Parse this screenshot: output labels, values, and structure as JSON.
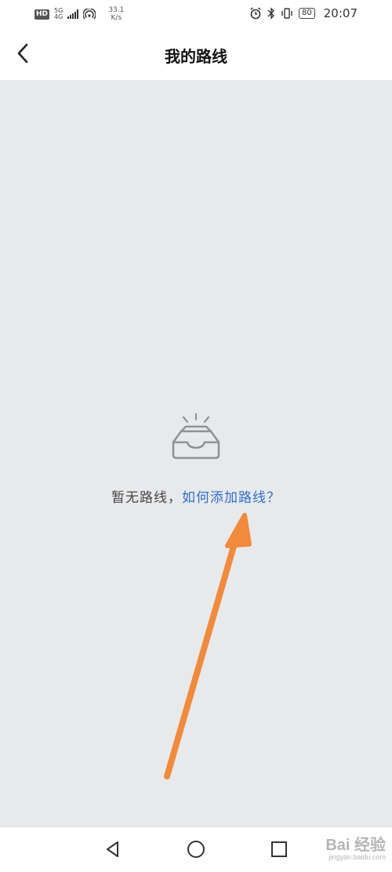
{
  "status_bar": {
    "hd": "HD",
    "network_gen": "5G",
    "network_sub": "4G",
    "speed_value": "33.1",
    "speed_unit": "K/s",
    "battery": "80",
    "time": "20:07"
  },
  "header": {
    "title": "我的路线",
    "back_icon": "chevron-left-icon"
  },
  "empty_state": {
    "icon": "empty-inbox-icon",
    "message": "暂无路线，",
    "link": "如何添加路线？"
  },
  "annotation": {
    "color": "#f08a3c"
  },
  "nav_bar": {
    "back_icon": "triangle-back-icon",
    "home_icon": "circle-home-icon",
    "recents_icon": "square-recents-icon"
  },
  "watermark": {
    "text": "Bai 经验",
    "url": "jingyan.baidu.com"
  }
}
